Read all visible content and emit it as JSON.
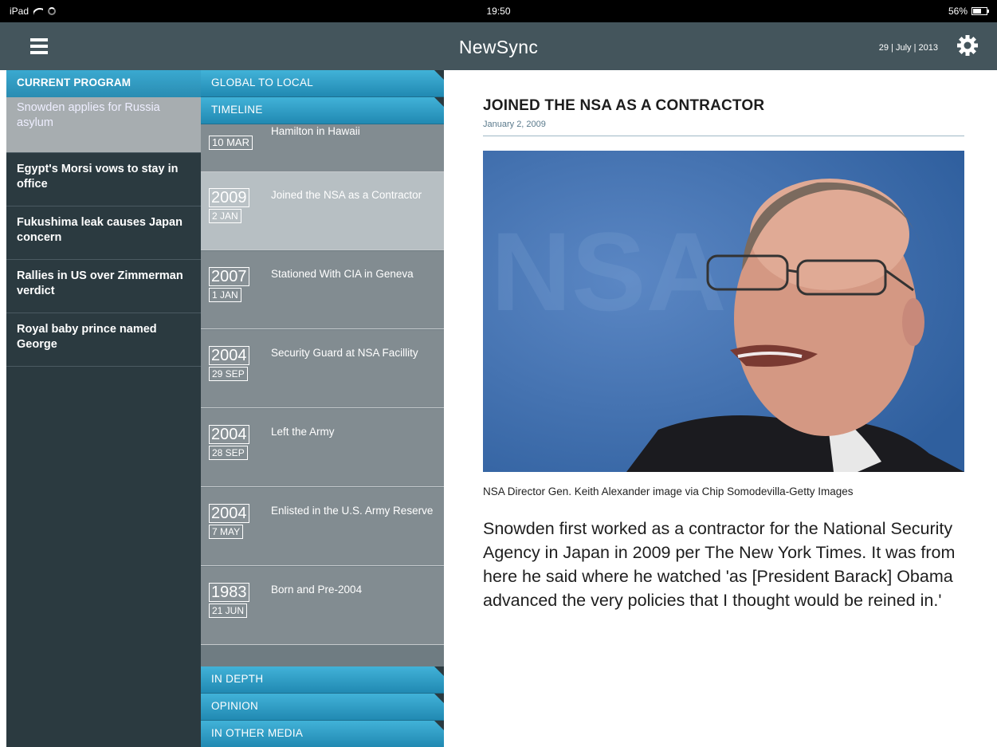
{
  "status_bar": {
    "device": "iPad",
    "time": "19:50",
    "battery": "56%"
  },
  "header": {
    "title": "NewSync",
    "date": "29 | July | 2013"
  },
  "left_panel": {
    "section_title": "CURRENT PROGRAM",
    "stories": [
      {
        "label": "Snowden applies for Russia asylum",
        "active": true
      },
      {
        "label": "Egypt's Morsi vows to stay in office",
        "active": false
      },
      {
        "label": "Fukushima leak causes Japan concern",
        "active": false
      },
      {
        "label": "Rallies in US over Zimmerman verdict",
        "active": false
      },
      {
        "label": "Royal baby prince named George",
        "active": false
      }
    ]
  },
  "middle_panel": {
    "tabs_top": [
      "GLOBAL TO LOCAL",
      "TIMELINE"
    ],
    "partial_item": {
      "day": "10 MAR",
      "text": "Hamilton in Hawaii"
    },
    "timeline": [
      {
        "year": "2009",
        "day": "2 JAN",
        "text": "Joined the NSA as a Contractor",
        "active": true
      },
      {
        "year": "2007",
        "day": "1 JAN",
        "text": "Stationed With CIA in Geneva",
        "active": false
      },
      {
        "year": "2004",
        "day": "29 SEP",
        "text": "Security Guard at NSA Facillity",
        "active": false
      },
      {
        "year": "2004",
        "day": "28 SEP",
        "text": "Left the Army",
        "active": false
      },
      {
        "year": "2004",
        "day": "7 MAY",
        "text": "Enlisted in the U.S. Army Reserve",
        "active": false
      },
      {
        "year": "1983",
        "day": "21 JUN",
        "text": "Born and Pre-2004",
        "active": false
      }
    ],
    "tabs_bottom": [
      "IN DEPTH",
      "OPINION",
      "IN OTHER MEDIA"
    ]
  },
  "article": {
    "title": "JOINED THE NSA AS A CONTRACTOR",
    "date": "January 2, 2009",
    "caption": "NSA Director Gen. Keith Alexander image via Chip Somodevilla-Getty Images",
    "body": "Snowden first worked as a contractor for the National Security Agency in Japan in 2009 per The New York Times. It was from here he said where he watched 'as [President Barack] Obama advanced the very policies that I thought would be reined in.'"
  },
  "colors": {
    "nav_bar": "#44555c",
    "panel_dark": "#2b3a40",
    "tab_blue": "#2a8cb2",
    "timeline_item": "#828c91",
    "timeline_active": "#b7bfc3",
    "story_active": "#a7adb0"
  },
  "icons": [
    "wifi-icon",
    "spinner-icon",
    "battery-icon",
    "menu-icon",
    "gear-icon"
  ]
}
